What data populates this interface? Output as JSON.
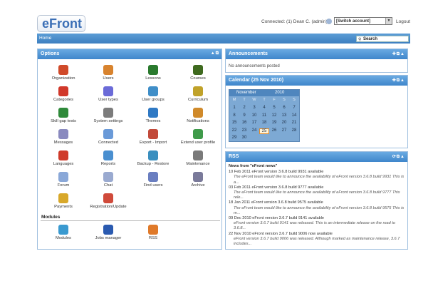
{
  "header": {
    "logo_text": "eFront",
    "connected": "Connected: (1)   Dean C. (admin)",
    "switch_account": "[Switch account]",
    "logout": "Logout"
  },
  "nav": {
    "home": "Home",
    "search": "Search"
  },
  "options": {
    "title": "Options",
    "items": [
      {
        "label": "Organization",
        "icon": "organization-icon",
        "color": "#d04a2a"
      },
      {
        "label": "Users",
        "icon": "users-icon",
        "color": "#d8832e"
      },
      {
        "label": "Lessons",
        "icon": "lessons-icon",
        "color": "#2a7a2e"
      },
      {
        "label": "Courses",
        "icon": "courses-icon",
        "color": "#3f6a1f"
      },
      {
        "label": "Categories",
        "icon": "categories-icon",
        "color": "#d1382a"
      },
      {
        "label": "User types",
        "icon": "user-types-icon",
        "color": "#6b6bd8"
      },
      {
        "label": "User groups",
        "icon": "user-groups-icon",
        "color": "#3f8ec8"
      },
      {
        "label": "Curriculum",
        "icon": "curriculum-icon",
        "color": "#c0a22a"
      },
      {
        "label": "Skill gap tests",
        "icon": "skill-gap-icon",
        "color": "#2f8a3a"
      },
      {
        "label": "System settings",
        "icon": "settings-icon",
        "color": "#7c7c7c"
      },
      {
        "label": "Themes",
        "icon": "themes-icon",
        "color": "#2f79c4"
      },
      {
        "label": "Notifications",
        "icon": "notifications-icon",
        "color": "#d08a2a"
      },
      {
        "label": "Messages",
        "icon": "messages-icon",
        "color": "#8a8abf"
      },
      {
        "label": "Connected",
        "icon": "connected-icon",
        "color": "#6a9ad8"
      },
      {
        "label": "Export - Import",
        "icon": "export-import-icon",
        "color": "#c24a3a"
      },
      {
        "label": "Extend user profile",
        "icon": "extend-profile-icon",
        "color": "#3f9a4a"
      },
      {
        "label": "Languages",
        "icon": "languages-icon",
        "color": "#cf3a2a"
      },
      {
        "label": "Reports",
        "icon": "reports-icon",
        "color": "#4a8fd0"
      },
      {
        "label": "Backup - Restore",
        "icon": "backup-icon",
        "color": "#3a8fbf"
      },
      {
        "label": "Maintenance",
        "icon": "maintenance-icon",
        "color": "#7a7a7a"
      },
      {
        "label": "Forum",
        "icon": "forum-icon",
        "color": "#8aa8d8"
      },
      {
        "label": "Chat",
        "icon": "chat-icon",
        "color": "#9aaad0"
      },
      {
        "label": "Find users",
        "icon": "find-users-icon",
        "color": "#6a7ec0"
      },
      {
        "label": "Archive",
        "icon": "archive-icon",
        "color": "#7a7a9a"
      },
      {
        "label": "Payments",
        "icon": "payments-icon",
        "color": "#d8a82a"
      },
      {
        "label": "Registration/Update",
        "icon": "registration-icon",
        "color": "#d04a3a"
      }
    ]
  },
  "modules": {
    "title": "Modules",
    "items": [
      {
        "label": "Modules",
        "icon": "modules-icon",
        "color": "#3a9ad0"
      },
      {
        "label": "Jobs manager",
        "icon": "jobs-icon",
        "color": "#2a5ab0"
      },
      {
        "label": "RSS",
        "icon": "rss-icon",
        "color": "#e07a2a"
      }
    ]
  },
  "announcements": {
    "title": "Announcements",
    "empty": "No announcements posted"
  },
  "calendar": {
    "title": "Calendar (25 Nov 2010)",
    "month": "November",
    "year": "2010",
    "weekdays": [
      "M",
      "T",
      "W",
      "T",
      "F",
      "S",
      "S"
    ],
    "weeks": [
      [
        "1",
        "2",
        "3",
        "4",
        "5",
        "6",
        "7"
      ],
      [
        "8",
        "9",
        "10",
        "11",
        "12",
        "13",
        "14"
      ],
      [
        "15",
        "16",
        "17",
        "18",
        "19",
        "20",
        "21"
      ],
      [
        "22",
        "23",
        "24",
        "25",
        "26",
        "27",
        "28"
      ],
      [
        "29",
        "30",
        "",
        "",
        "",
        "",
        ""
      ]
    ],
    "today": "25"
  },
  "rss": {
    "title": "RSS",
    "heading": "News from \"eFront news\"",
    "items": [
      {
        "date": "10 Feb 2011",
        "title": "eFront version 3.6.8 build 9931 available",
        "summary": "The eFront team would like to announce the availability of eFront version 3.6.8 build 9931 This is a..."
      },
      {
        "date": "03 Feb 2011",
        "title": "eFront version 3.6.8 build 9777 available",
        "summary": "The eFront team would like to announce the availability of eFront version 3.6.8 build 9777 This rele..."
      },
      {
        "date": "18 Jan 2011",
        "title": "eFront version 3.6.8 build 9575 available",
        "summary": "The eFront team would like to announce the availability of eFront version 3.6.8 build 9575 This is m..."
      },
      {
        "date": "09 Dec 2010",
        "title": "eFront version 3.6.7 build 9141 available",
        "summary": "eFront version 3.6.7 build 9141 was released. This is an intermediate release on the road to 3.6.8..."
      },
      {
        "date": "22 Nov 2010",
        "title": "eFront version 3.6.7 build 9006 now available",
        "summary": "eFront version 3.6.7 build 9006 was released. Although marked as maintenance release, 3.6.7 includes..."
      }
    ]
  }
}
